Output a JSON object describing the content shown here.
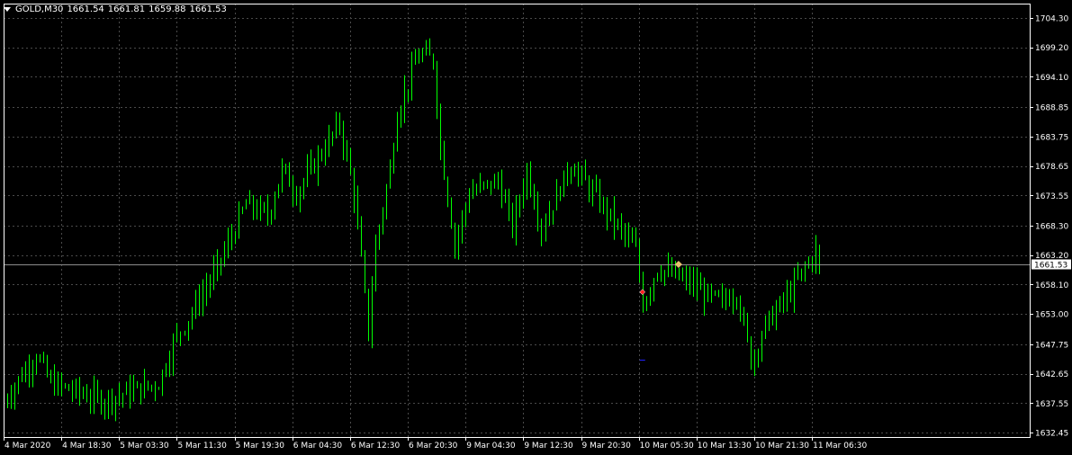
{
  "header": {
    "symbol": "GOLD,M30",
    "open": "1661.54",
    "high": "1661.81",
    "low": "1659.88",
    "close": "1661.53"
  },
  "colors": {
    "background": "#000000",
    "candle": "#00ff00",
    "grid": "#4a4a4a",
    "axis": "#ffffff",
    "bid_line": "#8c8c8c",
    "price_tag_bg": "#ffffff",
    "price_tag_text": "#000000",
    "sell_marker": "#ff2020",
    "buy_marker": "#e8c070",
    "stop_marker": "#2222ff"
  },
  "chart_data": {
    "type": "candlestick",
    "title": "GOLD,M30",
    "timeframe": "M30",
    "ylim": [
      1632.45,
      1706.0
    ],
    "grid": true,
    "y_ticks": [
      "1704.30",
      "1699.20",
      "1694.10",
      "1688.85",
      "1683.75",
      "1678.65",
      "1673.55",
      "1668.30",
      "1663.20",
      "1658.10",
      "1653.00",
      "1647.75",
      "1642.65",
      "1637.55",
      "1632.45"
    ],
    "x_ticks": [
      "4 Mar 2020",
      "4 Mar 18:30",
      "5 Mar 03:30",
      "5 Mar 11:30",
      "5 Mar 19:30",
      "6 Mar 04:30",
      "6 Mar 12:30",
      "6 Mar 20:30",
      "9 Mar 04:30",
      "9 Mar 12:30",
      "9 Mar 20:30",
      "10 Mar 05:30",
      "10 Mar 13:30",
      "10 Mar 21:30",
      "11 Mar 06:30"
    ],
    "current_price": "1661.53",
    "trade_markers": [
      {
        "type": "sell",
        "time": "10 Mar 06:30",
        "price": 1656.8
      },
      {
        "type": "buy",
        "time": "10 Mar 11:30",
        "price": 1661.6
      },
      {
        "type": "stop",
        "time": "10 Mar 06:30",
        "price": 1645.0
      }
    ],
    "close_path": [
      [
        "4 Mar 2020",
        1638
      ],
      [
        "4 Mar 18:30",
        1646
      ],
      [
        "4 Mar 20:30",
        1641
      ],
      [
        "5 Mar 03:30",
        1638
      ],
      [
        "5 Mar 11:30",
        1641
      ],
      [
        "5 Mar 13:30",
        1648
      ],
      [
        "5 Mar 19:30",
        1661
      ],
      [
        "5 Mar 23:30",
        1672
      ],
      [
        "6 Mar 02:30",
        1670
      ],
      [
        "6 Mar 04:30",
        1678
      ],
      [
        "6 Mar 06:30",
        1674
      ],
      [
        "6 Mar 12:30",
        1686
      ],
      [
        "6 Mar 14:30",
        1674
      ],
      [
        "6 Mar 16:30",
        1650
      ],
      [
        "6 Mar 17:30",
        1665
      ],
      [
        "6 Mar 19:30",
        1678
      ],
      [
        "6 Mar 20:30",
        1688
      ],
      [
        "6 Mar 23:30",
        1698
      ],
      [
        "9 Mar 01:30",
        1697
      ],
      [
        "9 Mar 02:30",
        1682
      ],
      [
        "9 Mar 04:30",
        1665
      ],
      [
        "9 Mar 06:30",
        1674
      ],
      [
        "9 Mar 10:30",
        1676
      ],
      [
        "9 Mar 12:30",
        1668
      ],
      [
        "9 Mar 14:30",
        1678
      ],
      [
        "9 Mar 16:30",
        1668
      ],
      [
        "9 Mar 20:30",
        1679
      ],
      [
        "10 Mar 02:30",
        1669
      ],
      [
        "10 Mar 05:30",
        1664
      ],
      [
        "10 Mar 06:30",
        1655
      ],
      [
        "10 Mar 08:30",
        1661
      ],
      [
        "10 Mar 13:30",
        1658
      ],
      [
        "10 Mar 15:30",
        1656
      ],
      [
        "10 Mar 17:30",
        1655
      ],
      [
        "10 Mar 19:30",
        1657
      ],
      [
        "10 Mar 21:30",
        1645
      ],
      [
        "10 Mar 23:30",
        1651
      ],
      [
        "11 Mar 02:30",
        1656
      ],
      [
        "11 Mar 06:30",
        1664
      ],
      [
        "11 Mar 07:00",
        1661.5
      ]
    ]
  }
}
